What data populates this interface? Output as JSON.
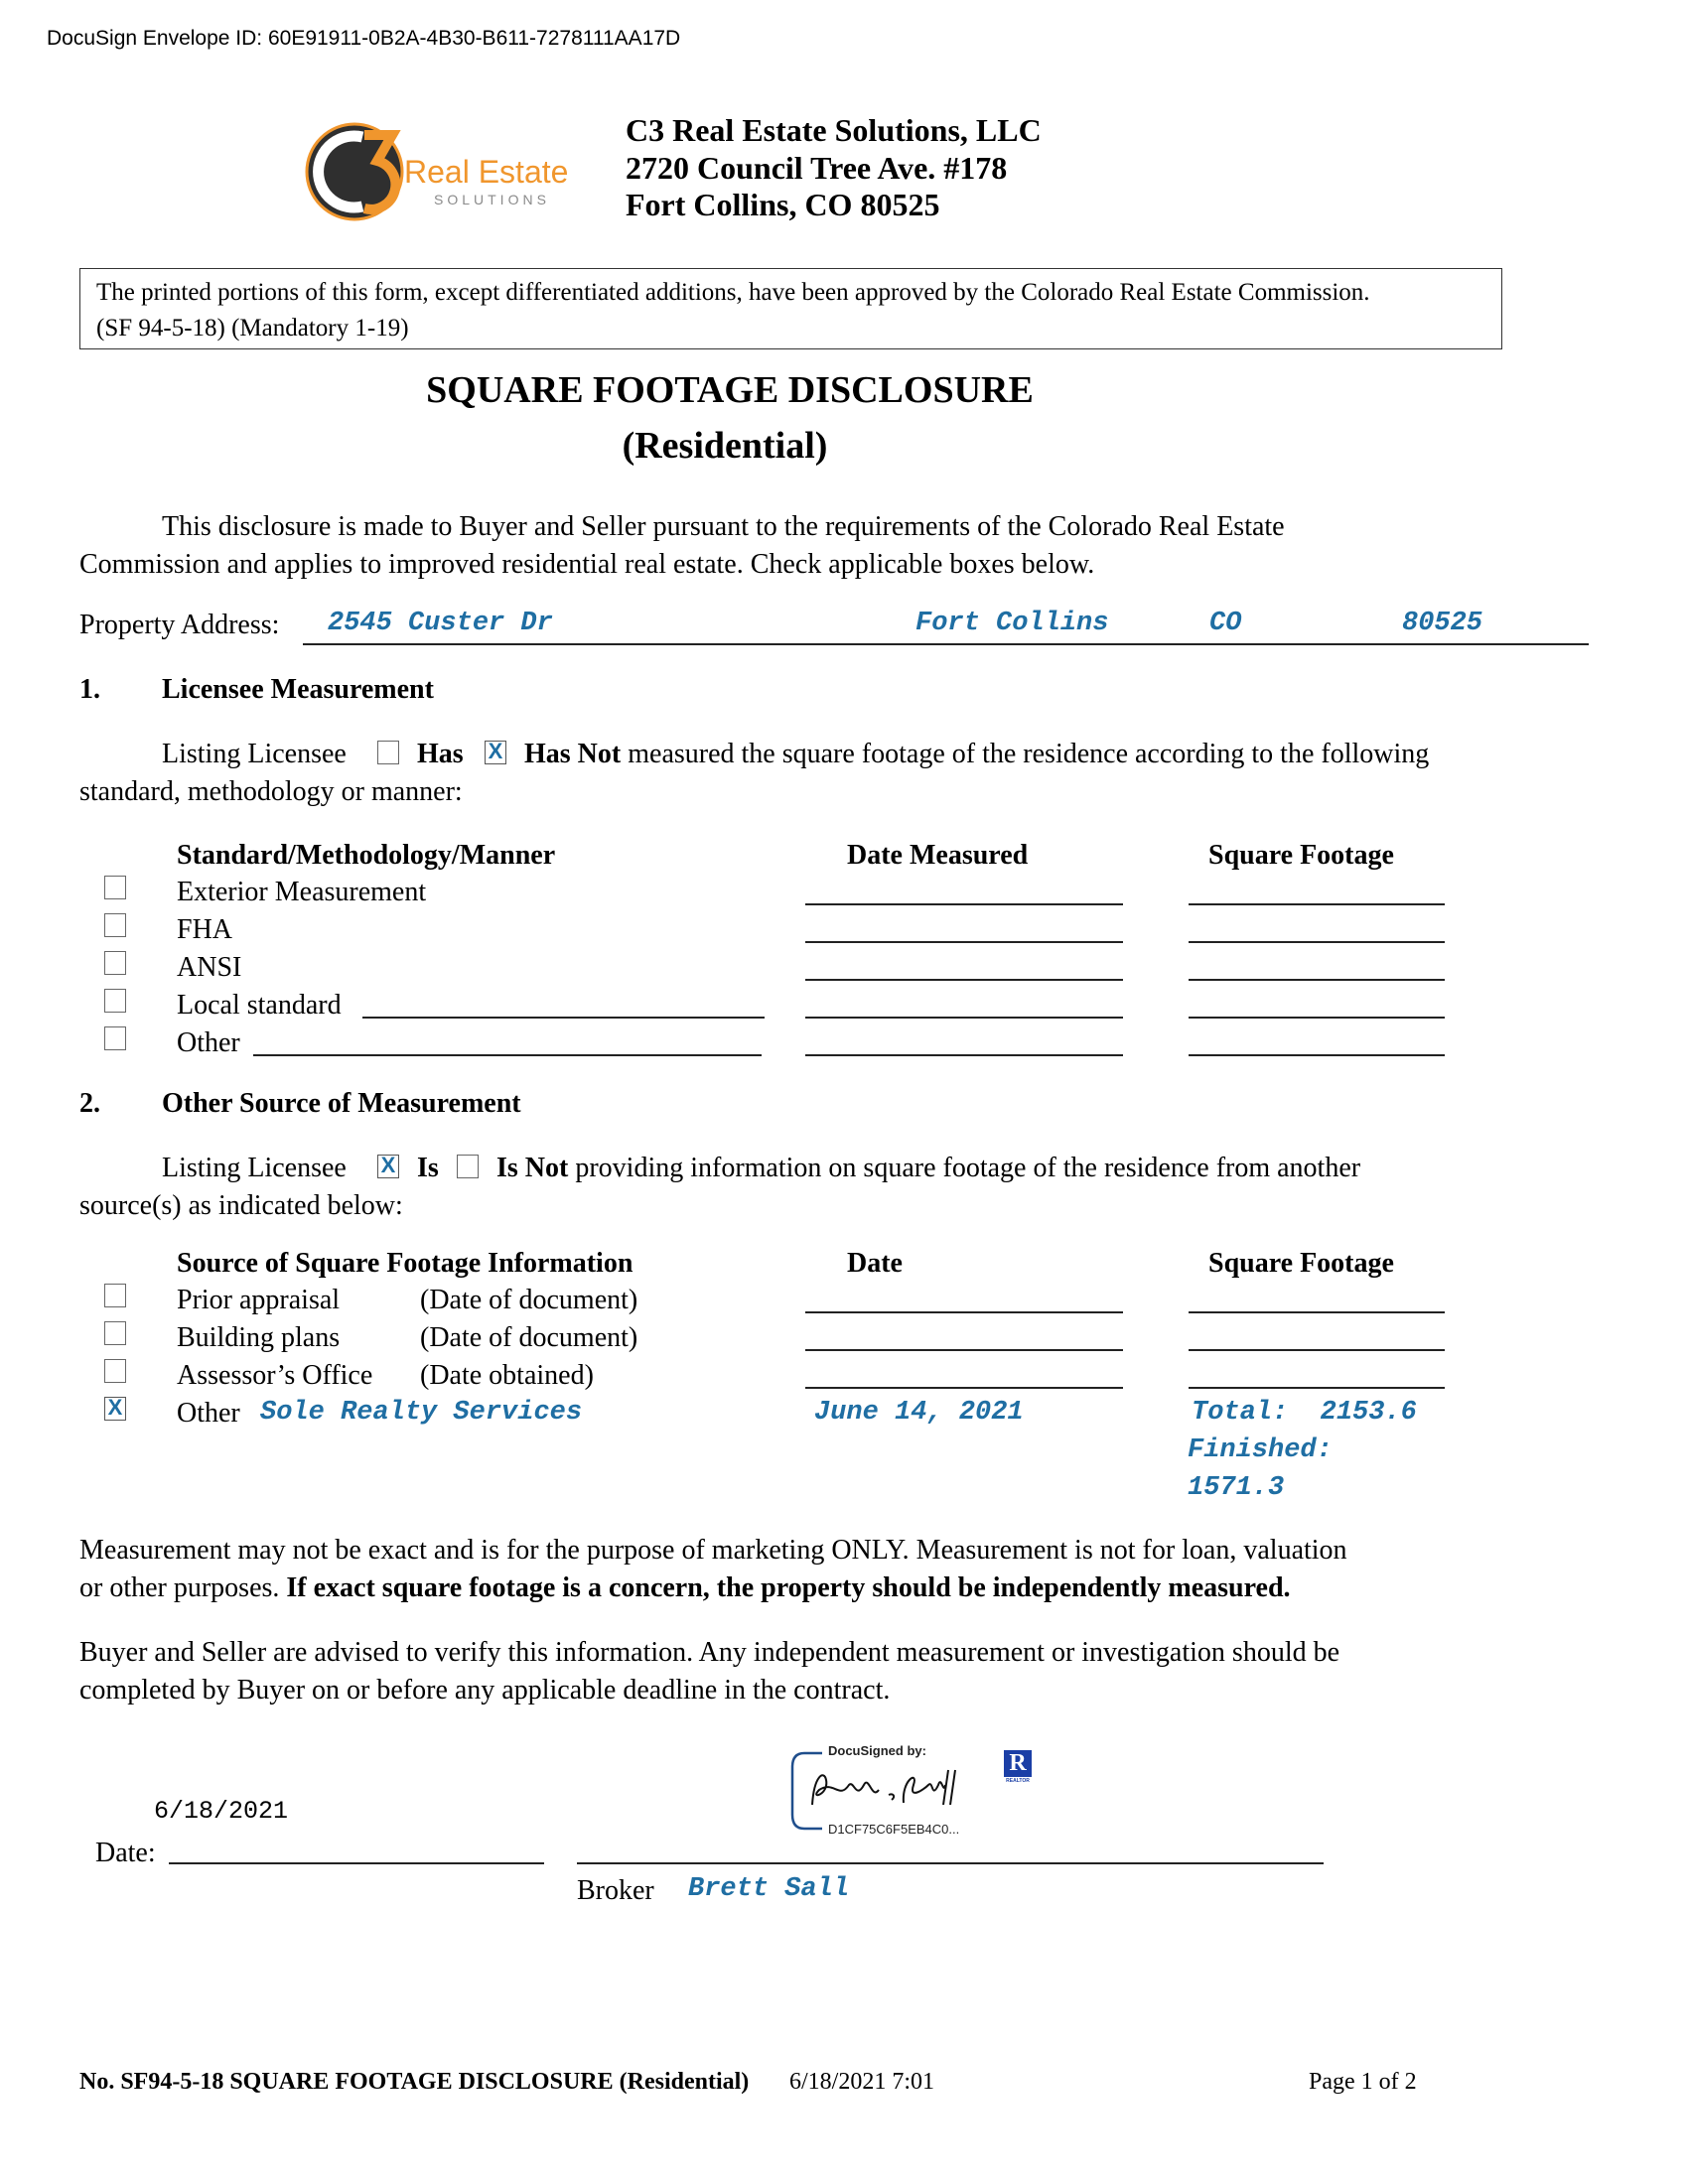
{
  "envelope": {
    "label": "DocuSign Envelope ID: 60E91911-0B2A-4B30-B611-7278111AA17D"
  },
  "logo": {
    "main_text": "Real Estate",
    "sub_text": "SOLUTIONS",
    "colors": {
      "orange": "#f0962d",
      "dark": "#2f2f2f",
      "gray": "#8a8a8a"
    }
  },
  "company": {
    "name": "C3 Real Estate Solutions, LLC",
    "address_line1": "2720 Council Tree Ave. #178",
    "address_line2": "Fort Collins, CO 80525"
  },
  "notice": {
    "line1": "The printed portions of this form, except differentiated additions, have been approved by the Colorado Real Estate Commission.",
    "line2": "(SF 94-5-18) (Mandatory 1-19)"
  },
  "title": "SQUARE FOOTAGE DISCLOSURE",
  "subtitle": "(Residential)",
  "intro": {
    "line1": "This disclosure is made to Buyer and Seller pursuant to the requirements of the Colorado Real Estate",
    "line2": "Commission and applies to improved residential real estate. Check applicable boxes below."
  },
  "property": {
    "label": "Property Address:",
    "street": "2545 Custer Dr",
    "city": "Fort Collins",
    "state": "CO",
    "zip": "80525"
  },
  "section1": {
    "number": "1.",
    "heading": "Licensee Measurement",
    "lead": "Listing Licensee",
    "has_label": "Has",
    "has_checked": false,
    "has_not_label": "Has Not",
    "has_not_checked": true,
    "rest_line1": "measured the square footage of the residence according to the following",
    "line2": "standard, methodology or manner:",
    "col_method": "Standard/Methodology/Manner",
    "col_date": "Date Measured",
    "col_sqft": "Square Footage",
    "rows": [
      {
        "label": "Exterior Measurement",
        "checked": false
      },
      {
        "label": "FHA",
        "checked": false
      },
      {
        "label": "ANSI",
        "checked": false
      },
      {
        "label": "Local standard",
        "checked": false
      },
      {
        "label": "Other",
        "checked": false
      }
    ]
  },
  "section2": {
    "number": "2.",
    "heading": "Other Source of Measurement",
    "lead": "Listing Licensee",
    "is_label": "Is",
    "is_checked": true,
    "is_not_label": "Is Not",
    "is_not_checked": false,
    "rest_line1": "providing information on square footage of the residence from another",
    "line2": "source(s) as indicated below:",
    "col_source": "Source of Square Footage Information",
    "col_date": "Date",
    "col_sqft": "Square Footage",
    "rows": [
      {
        "label": "Prior appraisal",
        "note": "(Date of document)",
        "checked": false
      },
      {
        "label": "Building plans",
        "note": "(Date of document)",
        "checked": false
      },
      {
        "label": "Assessor’s Office",
        "note": "(Date obtained)",
        "checked": false
      }
    ],
    "other": {
      "label": "Other",
      "checked": true,
      "source_value": "Sole Realty Services",
      "date_value": "June 14, 2021",
      "sqft_line1": "Total:  2153.6",
      "sqft_line2": "Finished:",
      "sqft_line3": "1571.3"
    }
  },
  "disclaimer": {
    "line1": "Measurement may not be exact and is for the purpose of marketing ONLY. Measurement is not for loan, valuation",
    "line2_plain": "or other purposes.",
    "line2_bold": "If exact square footage is a concern, the property should be independently measured."
  },
  "advice": {
    "line1": "Buyer and Seller are advised to verify this information. Any independent measurement or investigation should be",
    "line2": "completed by Buyer on or before any applicable deadline in the contract."
  },
  "signature": {
    "date_value": "6/18/2021",
    "date_label": "Date:",
    "docusigned_label": "DocuSigned by:",
    "signature_text": "Brett A. Sall",
    "signature_id": "D1CF75C6F5EB4C0...",
    "realtor_label": "REALTOR",
    "broker_label": "Broker",
    "broker_name": "Brett Sall"
  },
  "footer": {
    "form_label": "No. SF94-5-18 SQUARE FOOTAGE DISCLOSURE (Residential)",
    "timestamp": "6/18/2021 7:01",
    "page": "Page 1 of 2"
  }
}
